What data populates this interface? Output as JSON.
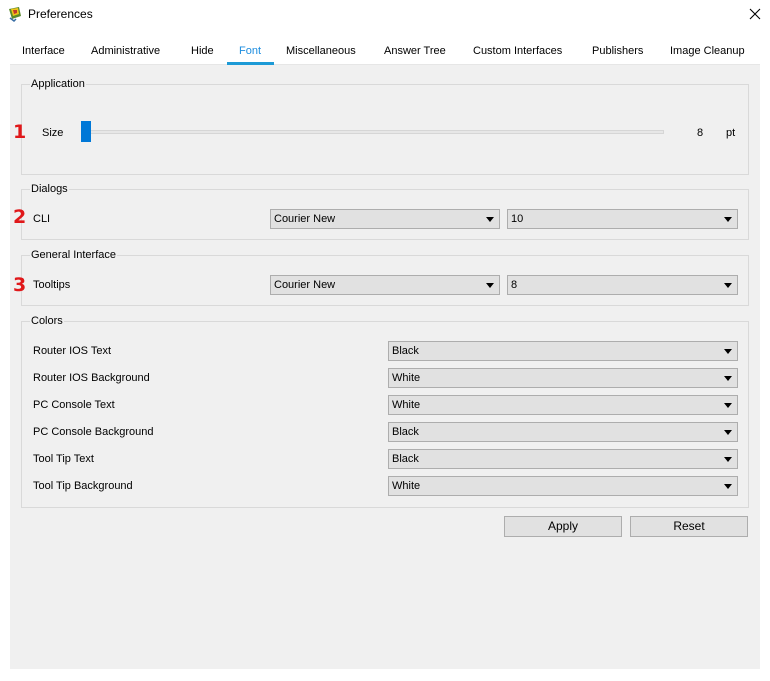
{
  "window": {
    "title": "Preferences",
    "app_icon": "packet-tracer-icon",
    "close_icon": "close-icon"
  },
  "tabs": [
    {
      "label": "Interface",
      "active": false
    },
    {
      "label": "Administrative",
      "active": false
    },
    {
      "label": "Hide",
      "active": false
    },
    {
      "label": "Font",
      "active": true
    },
    {
      "label": "Miscellaneous",
      "active": false
    },
    {
      "label": "Answer Tree",
      "active": false
    },
    {
      "label": "Custom Interfaces",
      "active": false
    },
    {
      "label": "Publishers",
      "active": false
    },
    {
      "label": "Image Cleanup",
      "active": false
    }
  ],
  "annotations": {
    "marker_1": "1",
    "marker_2": "2",
    "marker_3": "3",
    "marker_color": "#e0181a"
  },
  "application": {
    "title": "Application",
    "size_label": "Size",
    "size_value": "8",
    "size_unit": "pt",
    "slider_fraction": 0.0
  },
  "dialogs": {
    "title": "Dialogs",
    "cli_label": "CLI",
    "cli_font": "Courier New",
    "cli_size": "10"
  },
  "general_interface": {
    "title": "General Interface",
    "tooltips_label": "Tooltips",
    "tooltips_font": "Courier New",
    "tooltips_size": "8"
  },
  "colors": {
    "title": "Colors",
    "rows": [
      {
        "label": "Router IOS Text",
        "value": "Black"
      },
      {
        "label": "Router IOS Background",
        "value": "White"
      },
      {
        "label": "PC Console Text",
        "value": "White"
      },
      {
        "label": "PC Console Background",
        "value": "Black"
      },
      {
        "label": "Tool Tip Text",
        "value": "Black"
      },
      {
        "label": "Tool Tip Background",
        "value": "White"
      }
    ]
  },
  "buttons": {
    "apply": "Apply",
    "reset": "Reset"
  },
  "theme": {
    "accent": "#1d9ad6",
    "slider_thumb": "#0078d7",
    "panel_bg": "#f0f0f0",
    "combo_bg": "#e1e1e1"
  }
}
